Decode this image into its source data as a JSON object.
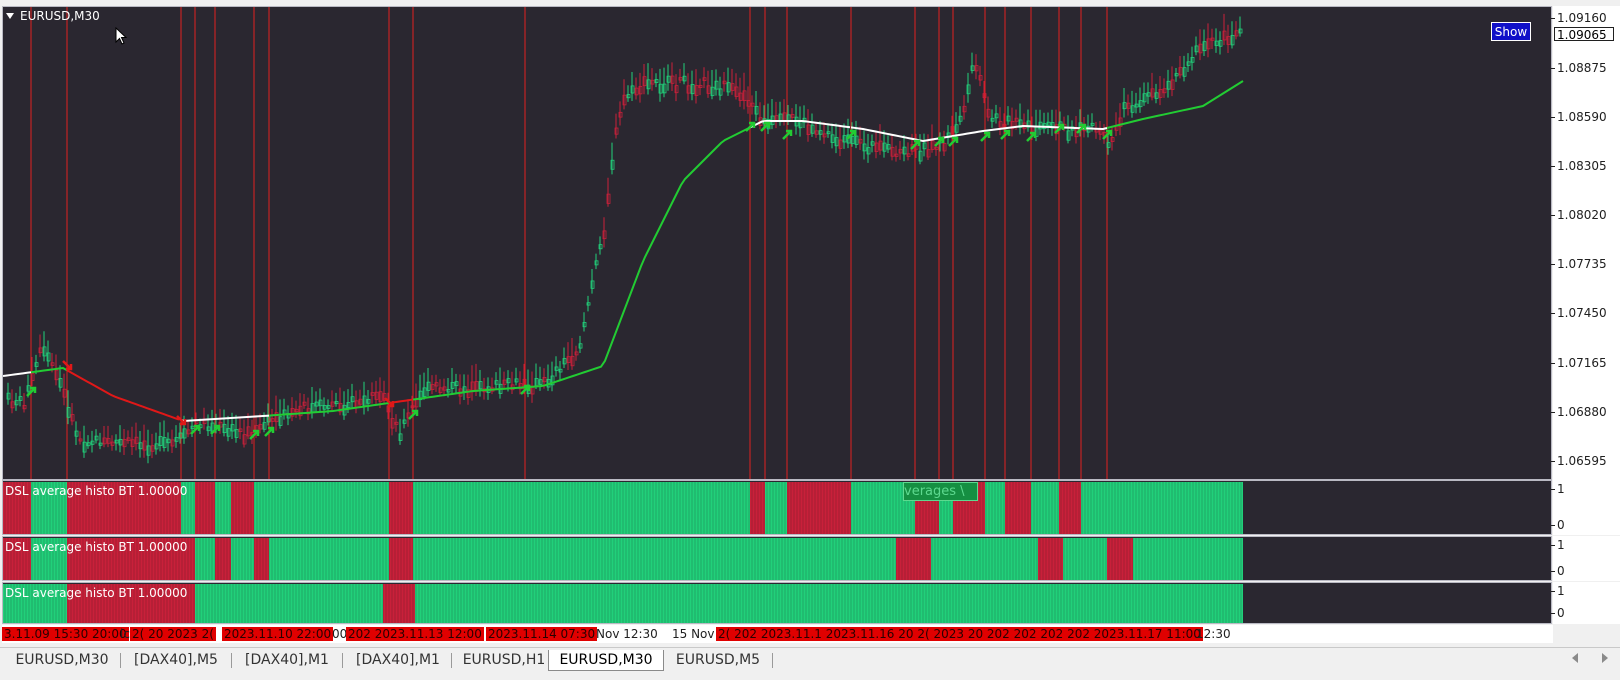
{
  "window": {
    "symbol_label": "EURUSD,M30",
    "show_button": "Show",
    "current_price": "1.09065"
  },
  "price_axis": [
    "1.09160",
    "1.08875",
    "1.08590",
    "1.08305",
    "1.08020",
    "1.07735",
    "1.07450",
    "1.07165",
    "1.06880",
    "1.06595"
  ],
  "indicators": [
    {
      "label": "DSL average histo BT 1.00000",
      "scale": [
        "1",
        "0"
      ]
    },
    {
      "label": "DSL average histo BT 1.00000",
      "scale": [
        "1",
        "0"
      ]
    },
    {
      "label": "DSL average histo BT 1.00000",
      "scale": [
        "1",
        "0"
      ]
    }
  ],
  "overlay_text": "verages \\",
  "time_axis": [
    {
      "text": "3.11.09 15:30 20:00",
      "highlight": true
    },
    {
      "text": "lc",
      "highlight": false
    },
    {
      "text": "2( 20 2023 2(",
      "highlight": true
    },
    {
      "text": "2023.11.10 22:00",
      "highlight": true
    },
    {
      "text": "00",
      "highlight": false
    },
    {
      "text": "202 2023.11.13 12:00",
      "highlight": true
    },
    {
      "text": "2023.11.14 07:30",
      "highlight": true
    },
    {
      "text": "Nov 12:30",
      "highlight": false
    },
    {
      "text": "15 Nov",
      "highlight": false
    },
    {
      "text": "2( 202 2023.11.1 2023.11.16 20 2( 2023 20 202 202 202 202 2023.11.17 11:00",
      "highlight": true
    },
    {
      "text": "12:30",
      "highlight": false
    }
  ],
  "tabs": [
    {
      "label": "EURUSD,M30",
      "active": false
    },
    {
      "label": "[DAX40],M5",
      "active": false
    },
    {
      "label": "[DAX40],M1",
      "active": false
    },
    {
      "label": "[DAX40],M1",
      "active": false
    },
    {
      "label": "EURUSD,H1",
      "active": false
    },
    {
      "label": "EURUSD,M30",
      "active": true
    },
    {
      "label": "EURUSD,M5",
      "active": false
    }
  ],
  "colors": {
    "background": "#2a2730",
    "bull": "#21d07a",
    "bear": "#c9203a",
    "vline": "#e02020",
    "ma_up": "#22cc33",
    "ma_down": "#e01818",
    "ma_flat": "#ffffff"
  }
}
